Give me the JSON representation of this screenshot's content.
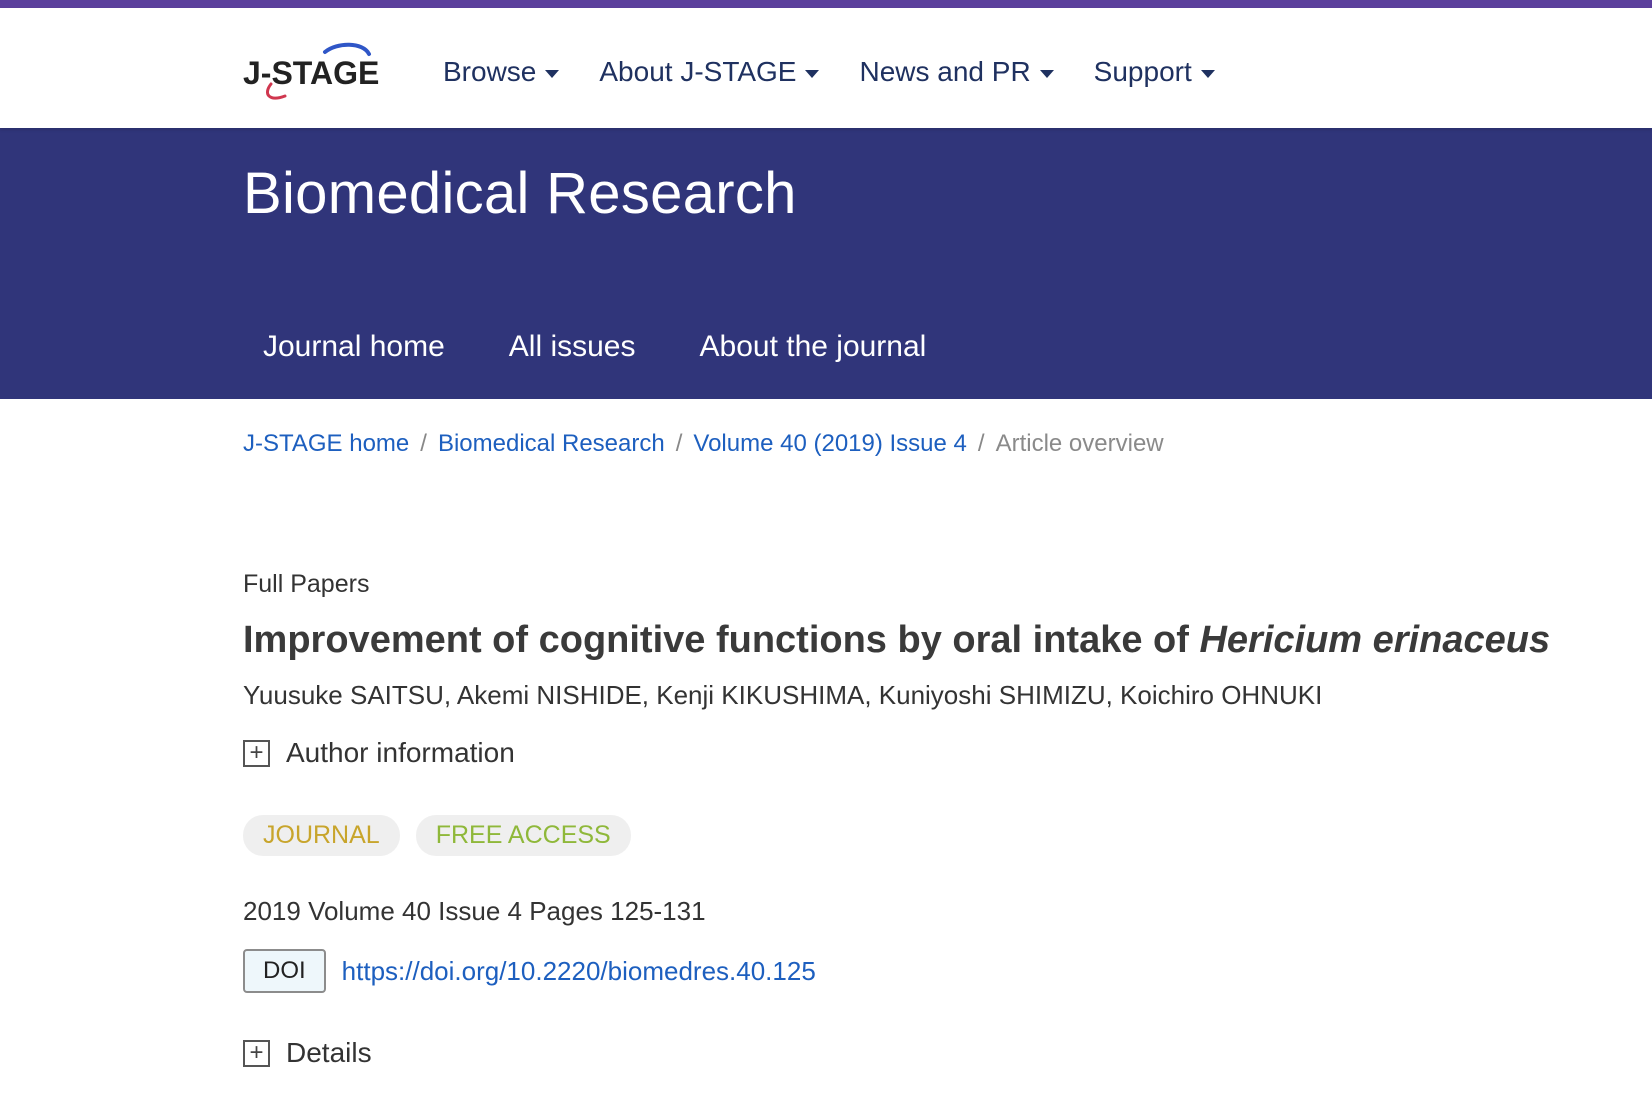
{
  "header": {
    "logo_text": "J-STAGE",
    "nav": [
      {
        "label": "Browse"
      },
      {
        "label": "About J-STAGE"
      },
      {
        "label": "News and PR"
      },
      {
        "label": "Support"
      }
    ]
  },
  "journal": {
    "title": "Biomedical Research",
    "nav": [
      {
        "label": "Journal home"
      },
      {
        "label": "All issues"
      },
      {
        "label": "About the journal"
      }
    ]
  },
  "breadcrumb": {
    "items": [
      {
        "label": "J-STAGE home"
      },
      {
        "label": "Biomedical Research"
      },
      {
        "label": "Volume 40 (2019) Issue 4"
      }
    ],
    "current": "Article overview",
    "separator": "/"
  },
  "article": {
    "type": "Full Papers",
    "title_plain": "Improvement of cognitive functions by oral intake of ",
    "title_italic": "Hericium erinaceus",
    "authors": "Yuusuke SAITSU, Akemi NISHIDE, Kenji KIKUSHIMA, Kuniyoshi SHIMIZU, Koichiro OHNUKI",
    "author_info_label": "Author information",
    "badges": {
      "journal": "JOURNAL",
      "free_access": "FREE ACCESS"
    },
    "citation": "2019 Volume 40 Issue 4 Pages 125-131",
    "doi_label": "DOI",
    "doi_url": "https://doi.org/10.2220/biomedres.40.125",
    "details_label": "Details",
    "expand_symbol": "+"
  },
  "colors": {
    "accent_bar": "#5b3f9c",
    "banner": "#30357a",
    "link": "#1d5fbf",
    "nav_text": "#1f3160",
    "badge_journal": "#c8a52c",
    "badge_free": "#8fb83a"
  }
}
